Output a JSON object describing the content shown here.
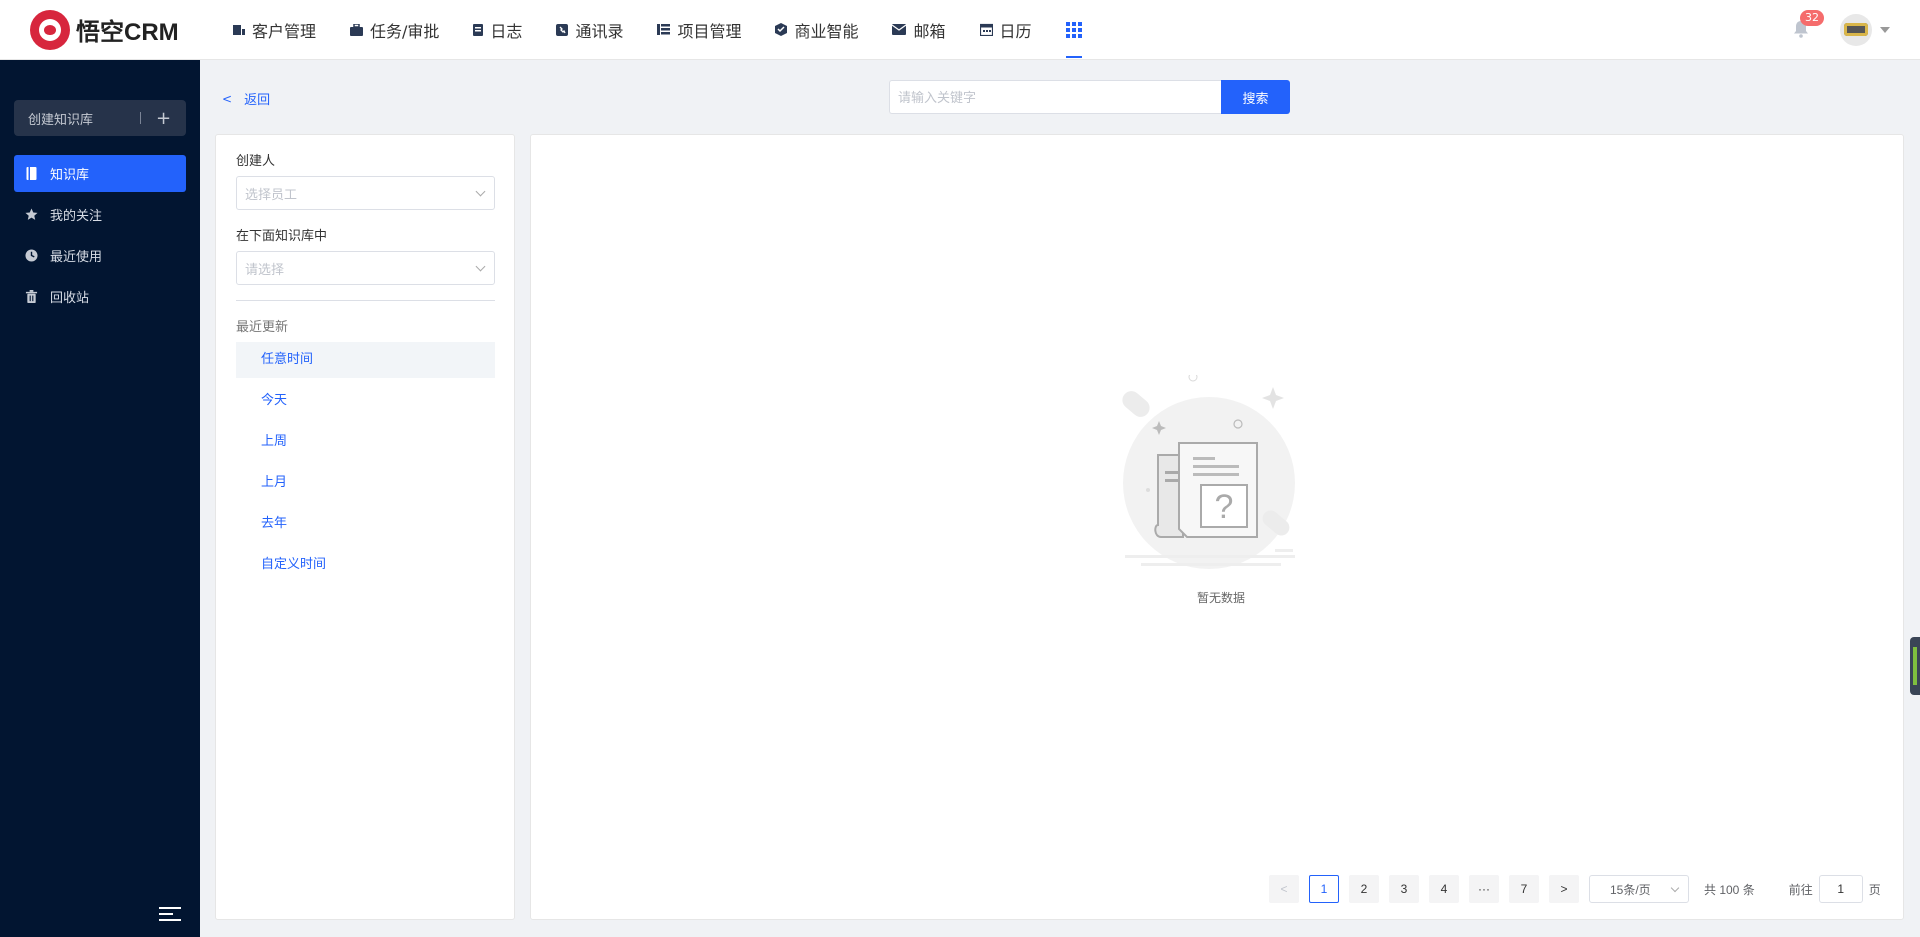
{
  "app": {
    "logo_text": "悟空CRM"
  },
  "nav": {
    "items": [
      {
        "label": "客户管理",
        "icon": "customer-icon"
      },
      {
        "label": "任务/审批",
        "icon": "briefcase-icon"
      },
      {
        "label": "日志",
        "icon": "log-icon"
      },
      {
        "label": "通讯录",
        "icon": "contacts-icon"
      },
      {
        "label": "项目管理",
        "icon": "project-icon"
      },
      {
        "label": "商业智能",
        "icon": "bi-icon"
      },
      {
        "label": "邮箱",
        "icon": "mail-icon"
      },
      {
        "label": "日历",
        "icon": "calendar-icon"
      }
    ],
    "notification_count": "32"
  },
  "sidebar": {
    "create_label": "创建知识库",
    "items": [
      {
        "label": "知识库",
        "icon": "book-icon",
        "active": true
      },
      {
        "label": "我的关注",
        "icon": "star-icon"
      },
      {
        "label": "最近使用",
        "icon": "clock-icon"
      },
      {
        "label": "回收站",
        "icon": "trash-icon"
      }
    ]
  },
  "header": {
    "back_label": "返回",
    "search_placeholder": "请输入关键字",
    "search_button": "搜索"
  },
  "filter": {
    "creator_label": "创建人",
    "creator_placeholder": "选择员工",
    "kb_label": "在下面知识库中",
    "kb_placeholder": "请选择",
    "recent_label": "最近更新",
    "time_options": [
      "任意时间",
      "今天",
      "上周",
      "上月",
      "去年",
      "自定义时间"
    ],
    "selected_time": "任意时间"
  },
  "content": {
    "empty_text": "暂无数据"
  },
  "pagination": {
    "pages": [
      "1",
      "2",
      "3",
      "4",
      "7"
    ],
    "ellipsis": "···",
    "current_page": "1",
    "page_size": "15条/页",
    "total": "共 100 条",
    "goto_prefix": "前往",
    "goto_value": "1",
    "goto_suffix": "页"
  },
  "colors": {
    "primary": "#2362fb",
    "sidebar_bg": "#021531",
    "badge": "#f56c6c"
  }
}
